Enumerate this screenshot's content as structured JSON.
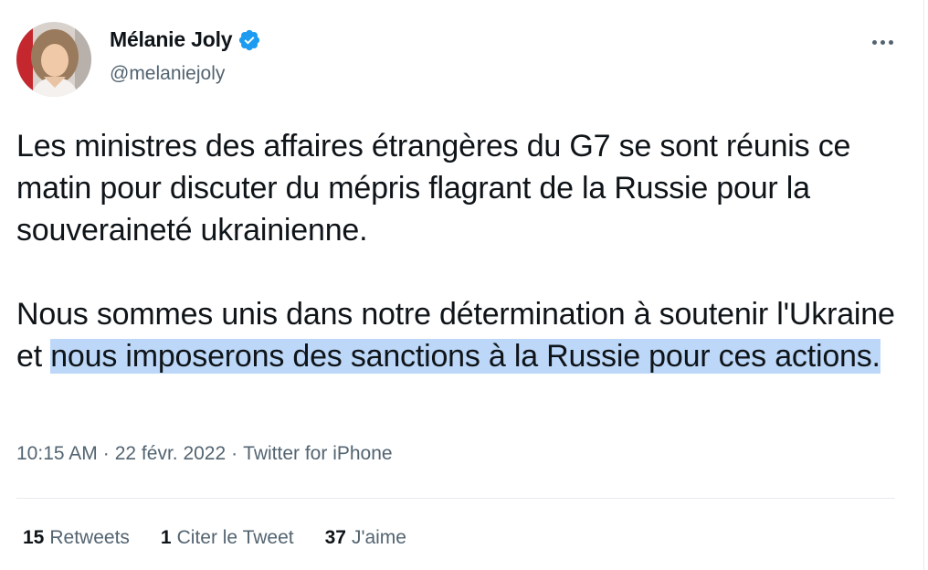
{
  "author": {
    "display_name": "Mélanie Joly",
    "handle": "@melaniejoly",
    "verified": true,
    "avatar": "profile-photo"
  },
  "tweet": {
    "paragraph1": "Les ministres des affaires étrangères du G7 se sont réunis ce matin pour discuter du mépris flagrant de la Russie pour la souveraineté ukrainienne.",
    "paragraph2_plain": "Nous sommes unis dans notre détermination à soutenir l'Ukraine et ",
    "paragraph2_highlighted": "nous imposerons des sanctions à la Russie pour ces actions."
  },
  "meta": {
    "time": "10:15 AM",
    "separator": "·",
    "date": "22 févr. 2022",
    "source": "Twitter for iPhone"
  },
  "stats": {
    "retweets_count": "15",
    "retweets_label": "Retweets",
    "quotes_count": "1",
    "quotes_label": "Citer le Tweet",
    "likes_count": "37",
    "likes_label": "J'aime"
  },
  "colors": {
    "verified": "#1d9bf0",
    "highlight": "#bcd7f7",
    "secondary_text": "#536471",
    "primary_text": "#0f1419"
  },
  "icons": [
    "verified-badge-icon",
    "more-options-icon"
  ]
}
